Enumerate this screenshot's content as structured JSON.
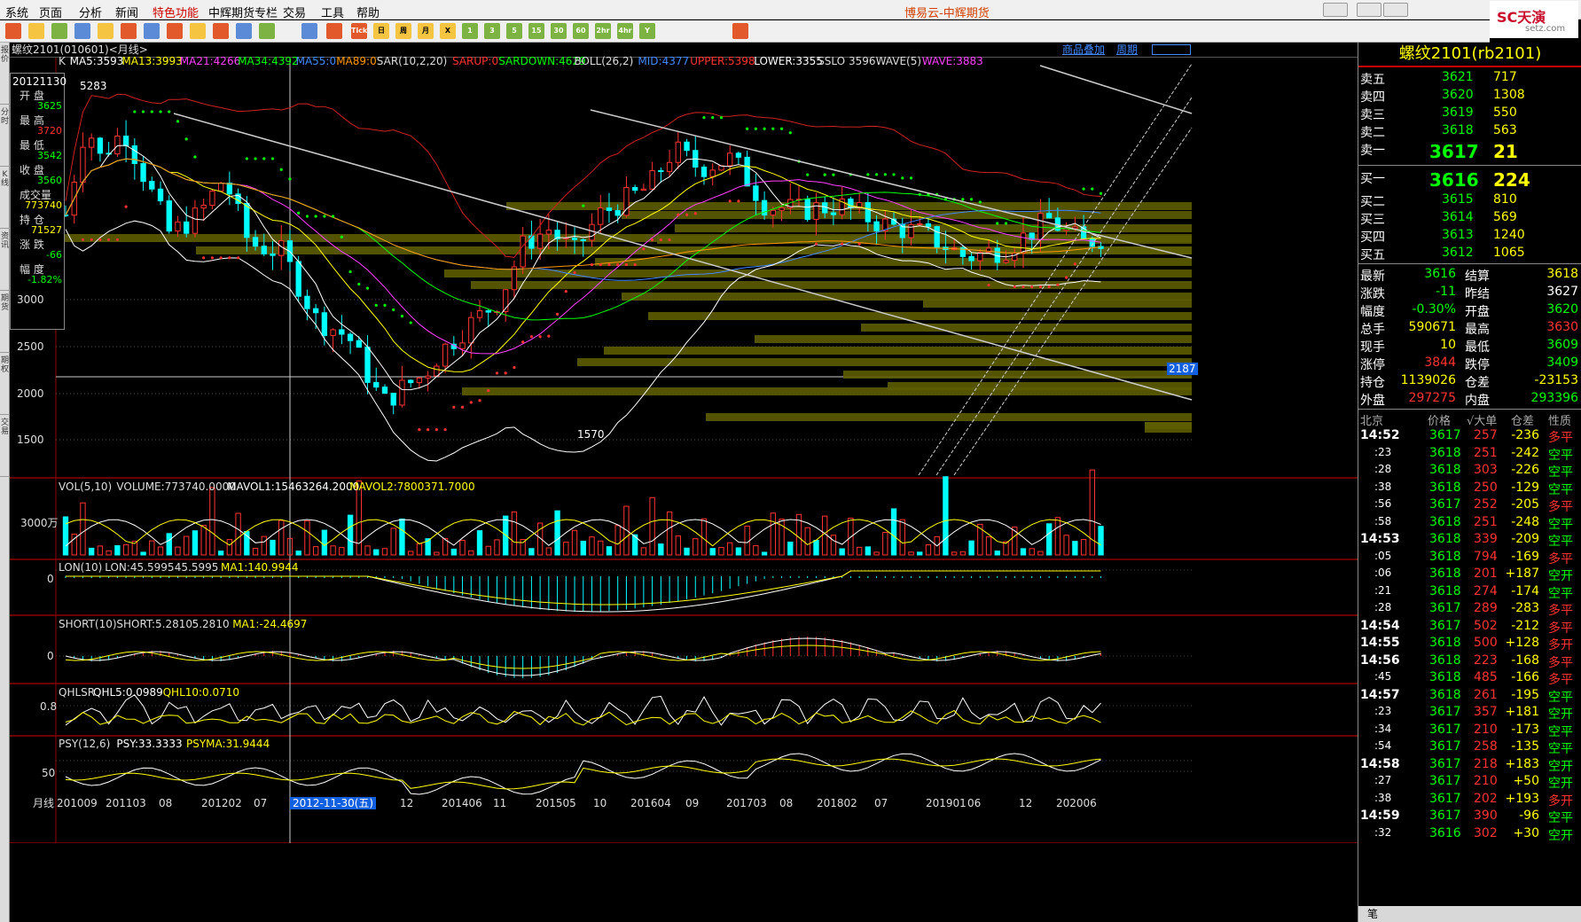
{
  "menubar": {
    "items": [
      "系统",
      "页面",
      "分析",
      "新闻",
      "特色功能",
      "中辉期货专栏",
      "交易",
      "工具",
      "帮助"
    ],
    "title": "博易云-中辉期货"
  },
  "brand": {
    "name": "SC天演",
    "sub": "setz.com"
  },
  "toolbar": {
    "buttons": [
      "Tick",
      "日",
      "周",
      "月",
      "X",
      "1",
      "3",
      "5",
      "15",
      "30",
      "60",
      "2hr",
      "4hr",
      "Y"
    ]
  },
  "left_tabs": [
    "报价",
    "分时",
    "K线",
    "资讯",
    "期货",
    "期权",
    "交易"
  ],
  "chart_header": {
    "title": "螺纹2101(010601)<月线>",
    "links": [
      "商品叠加",
      "周期"
    ]
  },
  "info_box": {
    "date": "20121130",
    "items": [
      {
        "label": "开 盘",
        "value": "3625",
        "color": "#00ff00"
      },
      {
        "label": "最 高",
        "value": "3720",
        "color": "#ff3333"
      },
      {
        "label": "最 低",
        "value": "3542",
        "color": "#00ff00"
      },
      {
        "label": "收 盘",
        "value": "3560",
        "color": "#00ff00"
      },
      {
        "label": "成交量",
        "value": "773740",
        "color": "#ffff00"
      },
      {
        "label": "持 仓",
        "value": "71527",
        "color": "#ffff00"
      },
      {
        "label": "涨 跌",
        "value": "-66",
        "color": "#00ff00"
      },
      {
        "label": "幅 度",
        "value": "-1.82%",
        "color": "#00ff00"
      }
    ]
  },
  "main_legend": [
    {
      "t": "K",
      "c": "#dddddd"
    },
    {
      "t": "MA5:3593",
      "c": "#ffffff"
    },
    {
      "t": "MA13:3993",
      "c": "#ffff00"
    },
    {
      "t": "MA21:4266",
      "c": "#ff40ff"
    },
    {
      "t": "MA34:4392",
      "c": "#00ff00"
    },
    {
      "t": "MA55:0",
      "c": "#4488ff"
    },
    {
      "t": "MA89:0",
      "c": "#ff9900"
    },
    {
      "t": "SAR(10,2,20)",
      "c": "#dddddd"
    },
    {
      "t": "SARUP:0",
      "c": "#ff3333"
    },
    {
      "t": "SARDOWN:4629",
      "c": "#00ff00"
    },
    {
      "t": "BOLL(26,2)",
      "c": "#dddddd"
    },
    {
      "t": "MID:4377",
      "c": "#4488ff"
    },
    {
      "t": "UPPER:5398",
      "c": "#ff3333"
    },
    {
      "t": "LOWER:3355",
      "c": "#ffffff"
    },
    {
      "t": "SSLO 3596",
      "c": "#dddddd"
    },
    {
      "t": "WAVE(5)",
      "c": "#dddddd"
    },
    {
      "t": "WAVE:3883",
      "c": "#ff40ff"
    }
  ],
  "price_axis": [
    "3000",
    "2500",
    "2000",
    "1500"
  ],
  "price_marks": {
    "high": "5283",
    "low": "1570",
    "cursor_price": "2187"
  },
  "volume_panel": {
    "legend": [
      {
        "t": "VOL(5,10)",
        "c": "#dddddd"
      },
      {
        "t": "VOLUME:773740.0000",
        "c": "#dddddd"
      },
      {
        "t": "MAVOL1:15463264.2000",
        "c": "#ffffff"
      },
      {
        "t": "MAVOL2:7800371.7000",
        "c": "#ffff00"
      }
    ],
    "axis": "3000万"
  },
  "lon_panel": {
    "legend": [
      {
        "t": "LON(10)",
        "c": "#dddddd"
      },
      {
        "t": "LON:45.5995",
        "c": "#dddddd"
      },
      {
        "t": "45.5995",
        "c": "#dddddd"
      },
      {
        "t": "MA1:140.9944",
        "c": "#ffff00"
      }
    ],
    "axis": "0"
  },
  "short_panel": {
    "legend": [
      {
        "t": "SHORT(10)",
        "c": "#dddddd"
      },
      {
        "t": "SHORT:5.2810",
        "c": "#dddddd"
      },
      {
        "t": "5.2810",
        "c": "#dddddd"
      },
      {
        "t": "MA1:-24.4697",
        "c": "#ffff00"
      }
    ],
    "axis": "0"
  },
  "qhlsr_panel": {
    "legend": [
      {
        "t": "QHLSR",
        "c": "#dddddd"
      },
      {
        "t": "QHL5:0.0989",
        "c": "#ffffff"
      },
      {
        "t": "QHL10:0.0710",
        "c": "#ffff00"
      }
    ],
    "axis": "0.8"
  },
  "psy_panel": {
    "legend": [
      {
        "t": "PSY(12,6)",
        "c": "#dddddd"
      },
      {
        "t": "PSY:33.3333",
        "c": "#ffffff"
      },
      {
        "t": "PSYMA:31.9444",
        "c": "#ffff00"
      }
    ],
    "axis": "50"
  },
  "time_axis": {
    "label": "月线",
    "ticks": [
      "201009",
      "201103",
      "08",
      "201202",
      "07",
      "12",
      "201406",
      "11",
      "201505",
      "10",
      "201604",
      "09",
      "201703",
      "08",
      "201802",
      "07",
      "201901",
      "06",
      "12",
      "202006"
    ],
    "cursor": "2012-11-30(五)"
  },
  "right_panel": {
    "title": "螺纹2101(rb2101)",
    "asks": [
      {
        "l": "卖五",
        "p": "3621",
        "v": "717"
      },
      {
        "l": "卖四",
        "p": "3620",
        "v": "1308"
      },
      {
        "l": "卖三",
        "p": "3619",
        "v": "550"
      },
      {
        "l": "卖二",
        "p": "3618",
        "v": "563"
      },
      {
        "l": "卖一",
        "p": "3617",
        "v": "21"
      }
    ],
    "bids": [
      {
        "l": "买一",
        "p": "3616",
        "v": "224"
      },
      {
        "l": "买二",
        "p": "3615",
        "v": "810"
      },
      {
        "l": "买三",
        "p": "3614",
        "v": "569"
      },
      {
        "l": "买四",
        "p": "3613",
        "v": "1240"
      },
      {
        "l": "买五",
        "p": "3612",
        "v": "1065"
      }
    ],
    "stats": [
      {
        "l1": "最新",
        "v1": "3616",
        "c1": "#00ff00",
        "l2": "结算",
        "v2": "3618",
        "c2": "#ffff00"
      },
      {
        "l1": "涨跌",
        "v1": "-11",
        "c1": "#00ff00",
        "l2": "昨结",
        "v2": "3627",
        "c2": "#ffffff"
      },
      {
        "l1": "幅度",
        "v1": "-0.30%",
        "c1": "#00ff00",
        "l2": "开盘",
        "v2": "3620",
        "c2": "#00ff00"
      },
      {
        "l1": "总手",
        "v1": "590671",
        "c1": "#ffff00",
        "l2": "最高",
        "v2": "3630",
        "c2": "#ff3333"
      },
      {
        "l1": "现手",
        "v1": "10",
        "c1": "#ffff00",
        "l2": "最低",
        "v2": "3609",
        "c2": "#00ff00"
      },
      {
        "l1": "涨停",
        "v1": "3844",
        "c1": "#ff3333",
        "l2": "跌停",
        "v2": "3409",
        "c2": "#00ff00"
      },
      {
        "l1": "持仓",
        "v1": "1139026",
        "c1": "#ffff00",
        "l2": "仓差",
        "v2": "-23153",
        "c2": "#ffff00"
      },
      {
        "l1": "外盘",
        "v1": "297275",
        "c1": "#ff3333",
        "l2": "内盘",
        "v2": "293396",
        "c2": "#00ff00"
      }
    ],
    "ticks_header": [
      "北京",
      "价格",
      "√大单",
      "仓差",
      "性质"
    ],
    "ticks": [
      {
        "t": "14:52",
        "p": "3617",
        "v": "257",
        "d": "-236",
        "n": "多平"
      },
      {
        "t": ":23",
        "p": "3618",
        "v": "251",
        "d": "-242",
        "n": "空平"
      },
      {
        "t": ":28",
        "p": "3618",
        "v": "303",
        "d": "-226",
        "n": "空平"
      },
      {
        "t": ":38",
        "p": "3618",
        "v": "250",
        "d": "-129",
        "n": "空平"
      },
      {
        "t": ":56",
        "p": "3617",
        "v": "252",
        "d": "-205",
        "n": "多平"
      },
      {
        "t": ":58",
        "p": "3618",
        "v": "251",
        "d": "-248",
        "n": "空平"
      },
      {
        "t": "14:53",
        "p": "3618",
        "v": "339",
        "d": "-209",
        "n": "空平"
      },
      {
        "t": ":05",
        "p": "3618",
        "v": "794",
        "d": "-169",
        "n": "多平"
      },
      {
        "t": ":06",
        "p": "3618",
        "v": "201",
        "d": "+187",
        "n": "空开"
      },
      {
        "t": ":21",
        "p": "3618",
        "v": "274",
        "d": "-174",
        "n": "空平"
      },
      {
        "t": ":28",
        "p": "3617",
        "v": "289",
        "d": "-283",
        "n": "多平"
      },
      {
        "t": "14:54",
        "p": "3617",
        "v": "502",
        "d": "-212",
        "n": "多平"
      },
      {
        "t": "14:55",
        "p": "3618",
        "v": "500",
        "d": "+128",
        "n": "多开"
      },
      {
        "t": "14:56",
        "p": "3618",
        "v": "223",
        "d": "-168",
        "n": "多平"
      },
      {
        "t": ":45",
        "p": "3618",
        "v": "485",
        "d": "-166",
        "n": "多平"
      },
      {
        "t": "14:57",
        "p": "3618",
        "v": "261",
        "d": "-195",
        "n": "空平"
      },
      {
        "t": ":23",
        "p": "3617",
        "v": "357",
        "d": "+181",
        "n": "空开"
      },
      {
        "t": ":34",
        "p": "3617",
        "v": "210",
        "d": "-173",
        "n": "空平"
      },
      {
        "t": ":54",
        "p": "3617",
        "v": "258",
        "d": "-135",
        "n": "空平"
      },
      {
        "t": "14:58",
        "p": "3617",
        "v": "218",
        "d": "+183",
        "n": "空开"
      },
      {
        "t": ":27",
        "p": "3617",
        "v": "210",
        "d": "+50",
        "n": "空开"
      },
      {
        "t": ":38",
        "p": "3617",
        "v": "202",
        "d": "+193",
        "n": "多开"
      },
      {
        "t": "14:59",
        "p": "3617",
        "v": "390",
        "d": "-96",
        "n": "空平"
      },
      {
        "t": ":32",
        "p": "3616",
        "v": "302",
        "d": "+30",
        "n": "空开"
      }
    ],
    "footer": "笔"
  },
  "colors": {
    "up": "#ff3333",
    "down": "#00ffff",
    "bg": "#000000",
    "grid": "#8b0000",
    "title": "#ffff00"
  }
}
